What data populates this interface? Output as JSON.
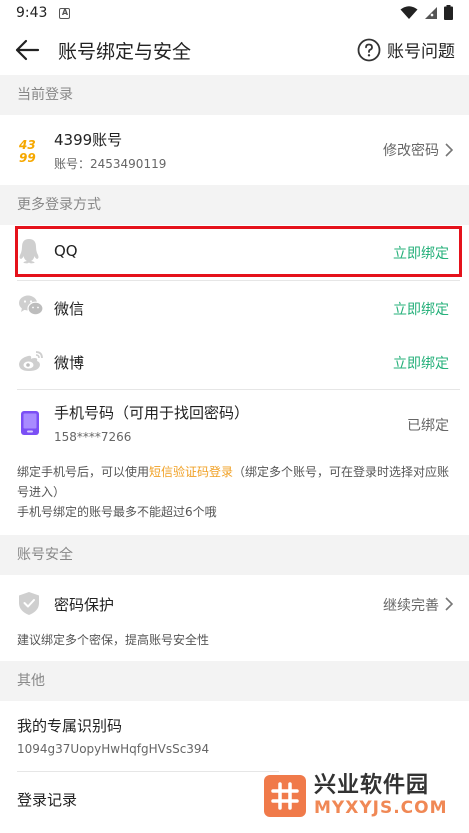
{
  "status": {
    "time": "9:43"
  },
  "app_bar": {
    "title": "账号绑定与安全",
    "help_label": "账号问题"
  },
  "current_login": {
    "header": "当前登录",
    "account_name": "4399账号",
    "account_id": "账号：2453490119",
    "action": "修改密码",
    "logo_text": [
      "43",
      "99"
    ]
  },
  "more_login": {
    "header": "更多登录方式",
    "items": [
      {
        "label": "QQ",
        "action": "立即绑定",
        "icon": "qq-icon"
      },
      {
        "label": "微信",
        "action": "立即绑定",
        "icon": "wechat-icon"
      },
      {
        "label": "微博",
        "action": "立即绑定",
        "icon": "weibo-icon"
      }
    ],
    "phone": {
      "label": "手机号码（可用于找回密码）",
      "number": "158****7266",
      "status": "已绑定"
    },
    "note_prefix": "绑定手机号后，可以使用",
    "note_highlight": "短信验证码登录",
    "note_suffix": "（绑定多个账号，可在登录时选择对应账号进入）",
    "note_line2": "手机号绑定的账号最多不能超过6个哦"
  },
  "security": {
    "header": "账号安全",
    "label": "密码保护",
    "action": "继续完善",
    "note": "建议绑定多个密保，提高账号安全性"
  },
  "other": {
    "header": "其他",
    "id_label": "我的专属识别码",
    "id_value": "1094g37UopyHwHqfgHVsSc394",
    "login_record": "登录记录"
  },
  "watermark": {
    "title": "兴业软件园",
    "url": "MYXYJS.COM"
  },
  "colors": {
    "accent_green": "#25b07a",
    "highlight_red": "#e5121b",
    "link_orange": "#f0a024"
  }
}
